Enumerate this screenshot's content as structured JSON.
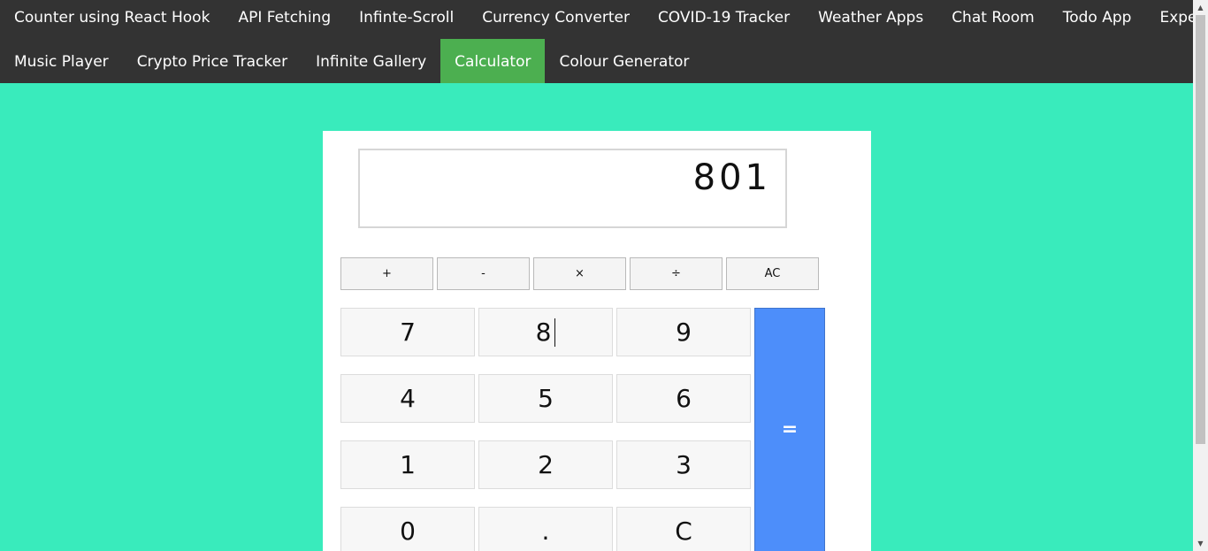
{
  "nav": {
    "row1": [
      "Counter using React Hook",
      "API Fetching",
      "Infinte-Scroll",
      "Currency Converter",
      "COVID-19 Tracker",
      "Weather Apps",
      "Chat Room",
      "Todo App",
      "Expense Tracker"
    ],
    "row2": [
      "Music Player",
      "Crypto Price Tracker",
      "Infinite Gallery",
      "Calculator",
      "Colour Generator"
    ],
    "active": "Calculator",
    "active_color": "#4caf50"
  },
  "calculator": {
    "display": "801",
    "operators": [
      "+",
      "-",
      "×",
      "÷",
      "AC"
    ],
    "keys": [
      "7",
      "8",
      "9",
      "4",
      "5",
      "6",
      "1",
      "2",
      "3",
      "0",
      ".",
      "C"
    ],
    "equals": "="
  },
  "colors": {
    "background": "#39ebbc",
    "nav": "#333333",
    "equals": "#4d8efa"
  }
}
